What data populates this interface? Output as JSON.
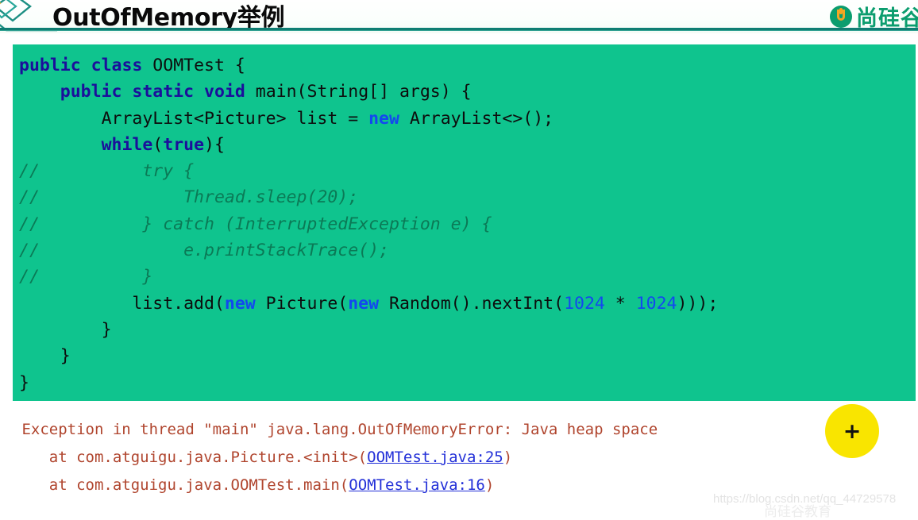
{
  "header": {
    "title": "OutOfMemory举例",
    "brand_text": "尚硅谷",
    "rule_color": "#0a6f66",
    "deco_color": "#1d8f83"
  },
  "code_block": {
    "background": "#0fc48e",
    "keyword_color": "#1b0f9b",
    "literal_color": "#1348ef",
    "comment_color": "#0b7a56",
    "text_color": "#0d0d0d",
    "lines": [
      {
        "indent": "",
        "segments": [
          {
            "t": "public",
            "c": "kw"
          },
          {
            "t": " ",
            "c": ""
          },
          {
            "t": "class",
            "c": "kw"
          },
          {
            "t": " OOMTest {",
            "c": ""
          }
        ]
      },
      {
        "indent": "    ",
        "segments": [
          {
            "t": "public",
            "c": "kw"
          },
          {
            "t": " ",
            "c": ""
          },
          {
            "t": "static",
            "c": "kw"
          },
          {
            "t": " ",
            "c": ""
          },
          {
            "t": "void",
            "c": "kw"
          },
          {
            "t": " main(String[] args) {",
            "c": ""
          }
        ]
      },
      {
        "indent": "        ",
        "segments": [
          {
            "t": "ArrayList<Picture> list = ",
            "c": ""
          },
          {
            "t": "new",
            "c": "nw"
          },
          {
            "t": " ArrayList<>();",
            "c": ""
          }
        ]
      },
      {
        "indent": "        ",
        "segments": [
          {
            "t": "while",
            "c": "kw"
          },
          {
            "t": "(",
            "c": ""
          },
          {
            "t": "true",
            "c": "kw"
          },
          {
            "t": "){",
            "c": ""
          }
        ]
      },
      {
        "indent": "",
        "segments": [
          {
            "t": "//          try {",
            "c": "cmt"
          }
        ]
      },
      {
        "indent": "",
        "segments": [
          {
            "t": "//              Thread.sleep(20);",
            "c": "cmt"
          }
        ]
      },
      {
        "indent": "",
        "segments": [
          {
            "t": "//          } catch (InterruptedException e) {",
            "c": "cmt"
          }
        ]
      },
      {
        "indent": "",
        "segments": [
          {
            "t": "//              e.printStackTrace();",
            "c": "cmt"
          }
        ]
      },
      {
        "indent": "",
        "segments": [
          {
            "t": "//          }",
            "c": "cmt"
          }
        ]
      },
      {
        "indent": "           ",
        "segments": [
          {
            "t": "list.add(",
            "c": ""
          },
          {
            "t": "new",
            "c": "nw"
          },
          {
            "t": " Picture(",
            "c": ""
          },
          {
            "t": "new",
            "c": "nw"
          },
          {
            "t": " Random().nextInt(",
            "c": ""
          },
          {
            "t": "1024",
            "c": "num"
          },
          {
            "t": " * ",
            "c": ""
          },
          {
            "t": "1024",
            "c": "num"
          },
          {
            "t": ")));",
            "c": ""
          }
        ]
      },
      {
        "indent": "        ",
        "segments": [
          {
            "t": "}",
            "c": ""
          }
        ]
      },
      {
        "indent": "    ",
        "segments": [
          {
            "t": "}",
            "c": ""
          }
        ]
      },
      {
        "indent": "",
        "segments": [
          {
            "t": "}",
            "c": ""
          }
        ]
      }
    ]
  },
  "console": {
    "text_color": "#b0452e",
    "link_color": "#2330d8",
    "lines": [
      {
        "indent": " ",
        "before": "Exception in thread \"main\" java.lang.OutOfMemoryError: Java heap space",
        "link": "",
        "after": ""
      },
      {
        "indent": "    ",
        "before": "at com.atguigu.java.Picture.<init>(",
        "link": "OOMTest.java:25",
        "after": ")"
      },
      {
        "indent": "    ",
        "before": "at com.atguigu.java.OOMTest.main(",
        "link": "OOMTest.java:16",
        "after": ")"
      }
    ]
  },
  "fab": {
    "label": "+",
    "color": "#f9e500"
  },
  "watermark": {
    "url": "https://blog.csdn.net/qq_44729578",
    "cn": "尚硅谷教育"
  }
}
